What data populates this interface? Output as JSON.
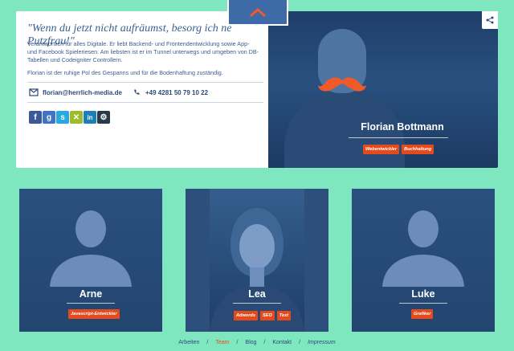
{
  "featured": {
    "quote": "\"Wenn du jetzt nicht aufräumst, besorg ich ne Putzfrau!\"",
    "desc1": "Verantwortlich für alles Digitale. Er liebt Backend- und Frontendentwicklung sowie App- und Facebook Spieleriesen. Am liebsten ist er im Tunnel unterwegs und umgeben von DB-Tabellen und Codeigniter Controllern.",
    "desc2": "Florian ist der ruhige Pol des Gespanns und für die Bodenhaftung zuständig.",
    "email": "florian@herrlich-media.de",
    "phone": "+49 4281 50 79 10 22",
    "name": "Florian Bottmann",
    "tags": [
      "Webentwickler",
      "Buchhaltung"
    ],
    "social": [
      "f",
      "g",
      "s",
      "x",
      "in",
      "steam"
    ]
  },
  "team": [
    {
      "name": "Arne",
      "tags": [
        "Javascript-Entwickler"
      ]
    },
    {
      "name": "Lea",
      "tags": [
        "Adwords",
        "SEO",
        "Text"
      ]
    },
    {
      "name": "Luke",
      "tags": [
        "Grafiker"
      ]
    }
  ],
  "nav": {
    "items": [
      "Arbeiten",
      "Team",
      "Blog",
      "Kontakt",
      "Impressum"
    ],
    "active": "Team",
    "separator": "/"
  },
  "colors": {
    "accent": "#e54a1c",
    "background": "#7fe7bf",
    "card": "#2a507f"
  }
}
